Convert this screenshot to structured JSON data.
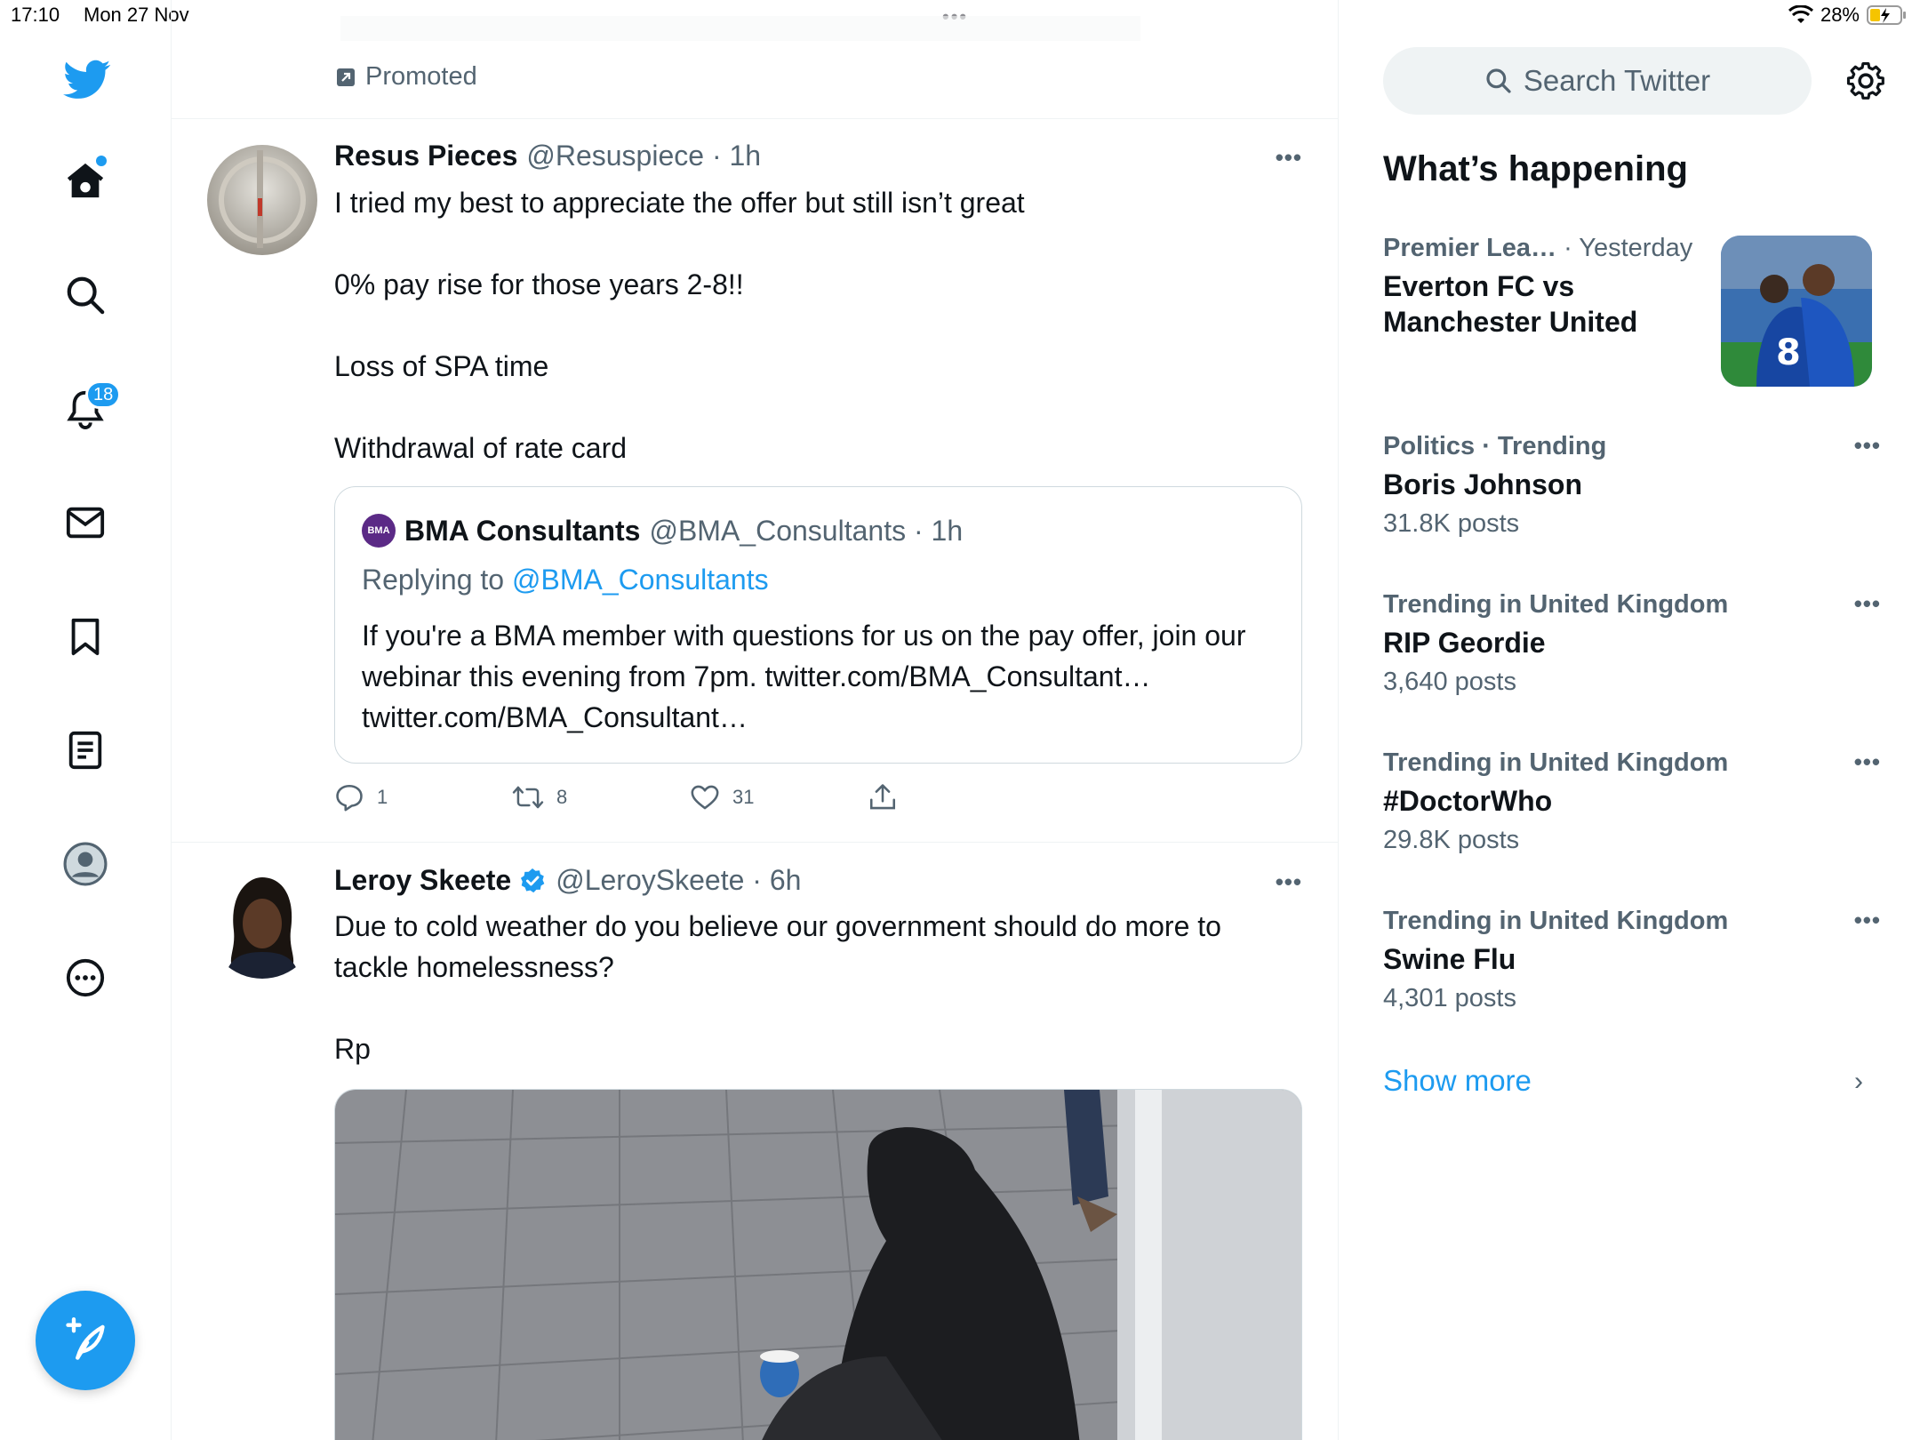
{
  "status_bar": {
    "time": "17:10",
    "date": "Mon 27 Nov",
    "multitask_dots": "•••",
    "battery": "28%"
  },
  "nav": {
    "notifications_badge": "18",
    "icons": [
      "twitter-bird-icon",
      "home-icon",
      "search-icon",
      "bell-icon",
      "mail-icon",
      "bookmark-icon",
      "lists-icon",
      "profile-icon",
      "more-icon",
      "compose-icon"
    ]
  },
  "feed": {
    "promoted_label": "Promoted",
    "tweets": [
      {
        "name": "Resus Pieces",
        "meta": "@Resuspiece · 1h",
        "more": "•••",
        "text_lines": [
          "I tried my best to appreciate the offer but still isn’t great",
          "0% pay rise for those years 2-8!!",
          "Loss of SPA time",
          "Withdrawal of rate card"
        ],
        "quote": {
          "avatar_text": "BMA",
          "name": "BMA Consultants",
          "meta": "@BMA_Consultants · 1h",
          "replying_prefix": "Replying to",
          "replying_to": "@BMA_Consultants",
          "text": "If you're a BMA member with questions for us on the pay offer, join our webinar this evening from 7pm. twitter.com/BMA_Consultant… twitter.com/BMA_Consultant…"
        },
        "replies": "1",
        "retweets": "8",
        "likes": "31"
      },
      {
        "name": "Leroy Skeete",
        "meta": "@LeroySkeete · 6h",
        "more": "•••",
        "text_lines": [
          "Due to cold weather do you believe our government should do more to tackle homelessness?",
          "Rp"
        ]
      }
    ]
  },
  "sidebar": {
    "search_placeholder": "Search Twitter",
    "title": "What’s happening",
    "trends": [
      {
        "context": "Premier Lea…",
        "context_time": "· Yesterday",
        "headline": "Everton FC vs Manchester United"
      },
      {
        "context": "Politics · Trending",
        "headline": "Boris Johnson",
        "posts": "31.8K posts"
      },
      {
        "context": "Trending in United Kingdom",
        "headline": "RIP Geordie",
        "posts": "3,640 posts"
      },
      {
        "context": "Trending in United Kingdom",
        "headline": "#DoctorWho",
        "posts": "29.8K posts"
      },
      {
        "context": "Trending in United Kingdom",
        "headline": "Swine Flu",
        "posts": "4,301 posts"
      }
    ],
    "show_more": "Show more",
    "more_dots": "•••",
    "chevron": "›"
  },
  "colors": {
    "accent": "#1d9bf0",
    "text_primary": "#0f1419",
    "text_secondary": "#536471",
    "divider": "#eff3f4"
  }
}
